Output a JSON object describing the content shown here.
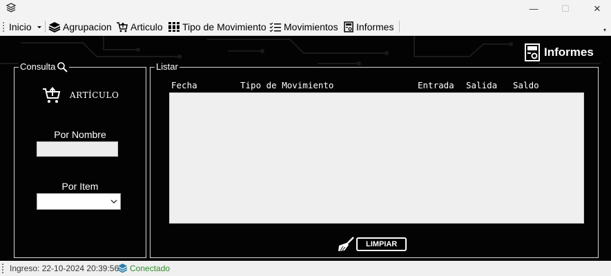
{
  "window": {
    "minimize_glyph": "—",
    "maximize_glyph": "☐",
    "close_glyph": "✕"
  },
  "menu": {
    "inicio": "Inicio",
    "agrupacion": "Agrupacion",
    "articulo": "Articulo",
    "tipo_movimiento": "Tipo de Movimiento",
    "movimientos": "Movimientos",
    "informes": "Informes"
  },
  "header": {
    "title": "Informes",
    "icon": "report-icon"
  },
  "consulta": {
    "legend": "Consulta",
    "articulo_label": "ARTÍCULO",
    "por_nombre_label": "Por Nombre",
    "por_nombre_value": "",
    "por_item_label": "Por Item",
    "por_item_value": ""
  },
  "listar": {
    "legend": "Listar",
    "columns": [
      "Fecha",
      "Tipo de Movimiento",
      "Entrada",
      "Salida",
      "Saldo"
    ],
    "rows": [],
    "limpiar_label": "LIMPIAR"
  },
  "status": {
    "ingreso": "Ingreso: 22-10-2024 20:39:56",
    "connection": "Conectado"
  },
  "colors": {
    "background": "#030303",
    "connected": "#2e8b2e",
    "chrome": "#f3f3f3"
  }
}
